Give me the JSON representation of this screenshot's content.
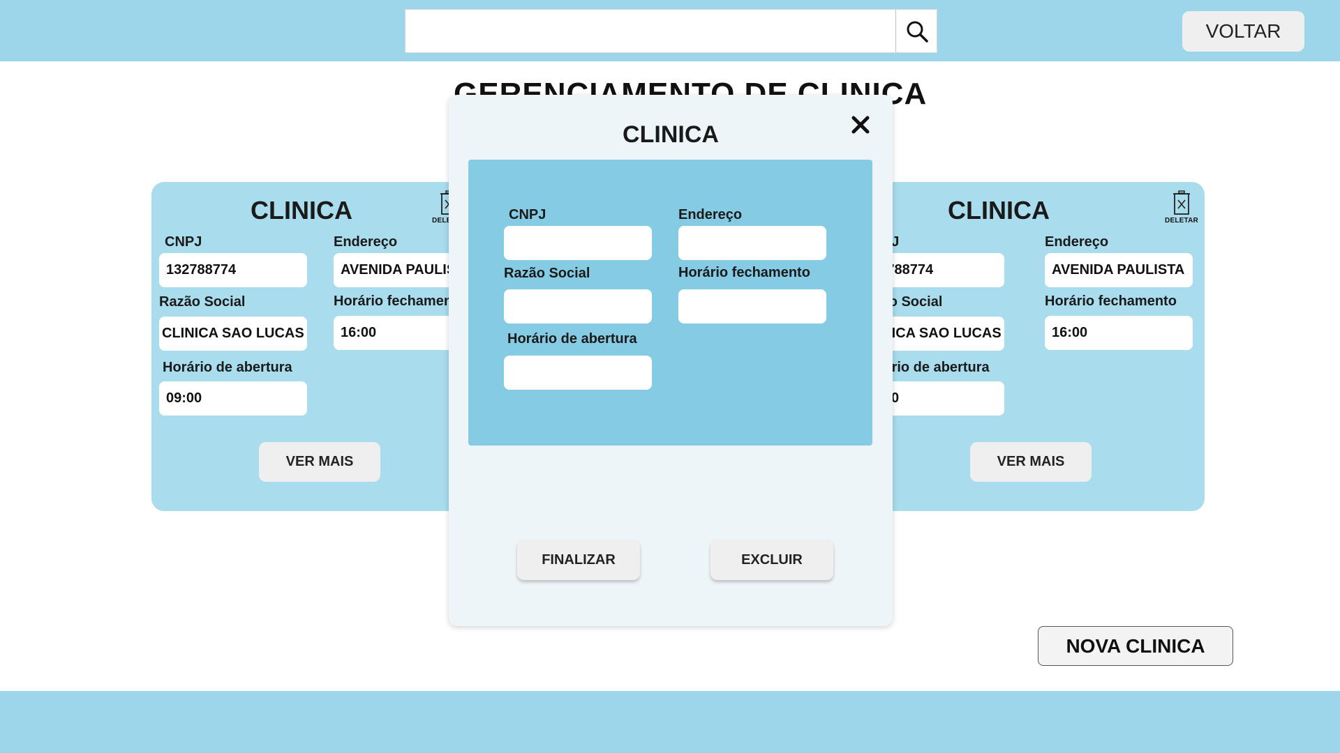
{
  "header": {
    "search": {
      "value": "",
      "placeholder": "",
      "icon": "search-icon"
    },
    "back_label": "VOLTAR"
  },
  "page_title": "GERENCIAMENTO DE CLINICA",
  "cards": [
    {
      "title": "CLINICA",
      "delete_label": "DELETAR",
      "cnpj_label": "CNPJ",
      "cnpj_value": "132788774",
      "address_label": "Endereço",
      "address_value": "AVENIDA PAULISTA",
      "company_label": "Razão Social",
      "company_value": "CLINICA SAO LUCAS",
      "closing_label": "Horário fechamento",
      "closing_value": "16:00",
      "opening_label": "Horário de abertura",
      "opening_value": "09:00",
      "more_label": "VER MAIS"
    },
    {
      "title": "CLINICA",
      "delete_label": "DELETAR",
      "cnpj_label": "CNPJ",
      "cnpj_value": "132788774",
      "address_label": "Endereço",
      "address_value": "AVENIDA PAULISTA",
      "company_label": "Razão Social",
      "company_value": "CLINICA SAO LUCAS",
      "closing_label": "Horário fechamento",
      "closing_value": "16:00",
      "opening_label": "Horário de abertura",
      "opening_value": "09:00",
      "more_label": "VER MAIS"
    }
  ],
  "new_clinic_label": "NOVA CLINICA",
  "modal": {
    "title": "CLINICA",
    "close_label": "x",
    "cnpj_label": "CNPJ",
    "cnpj_value": "",
    "address_label": "Endereço",
    "address_value": "",
    "company_label": "Razão Social",
    "company_value": "",
    "closing_label": "Horário fechamento",
    "closing_value": "",
    "opening_label": "Horário de abertura",
    "opening_value": "",
    "finish_label": "FINALIZAR",
    "delete_label": "EXCLUIR"
  },
  "colors": {
    "header_bg": "#9dd6ea",
    "card_bg": "#a9dcec",
    "modal_bg": "#eef5f8",
    "modal_panel_bg": "#86cbe4",
    "button_bg": "#efefef"
  }
}
